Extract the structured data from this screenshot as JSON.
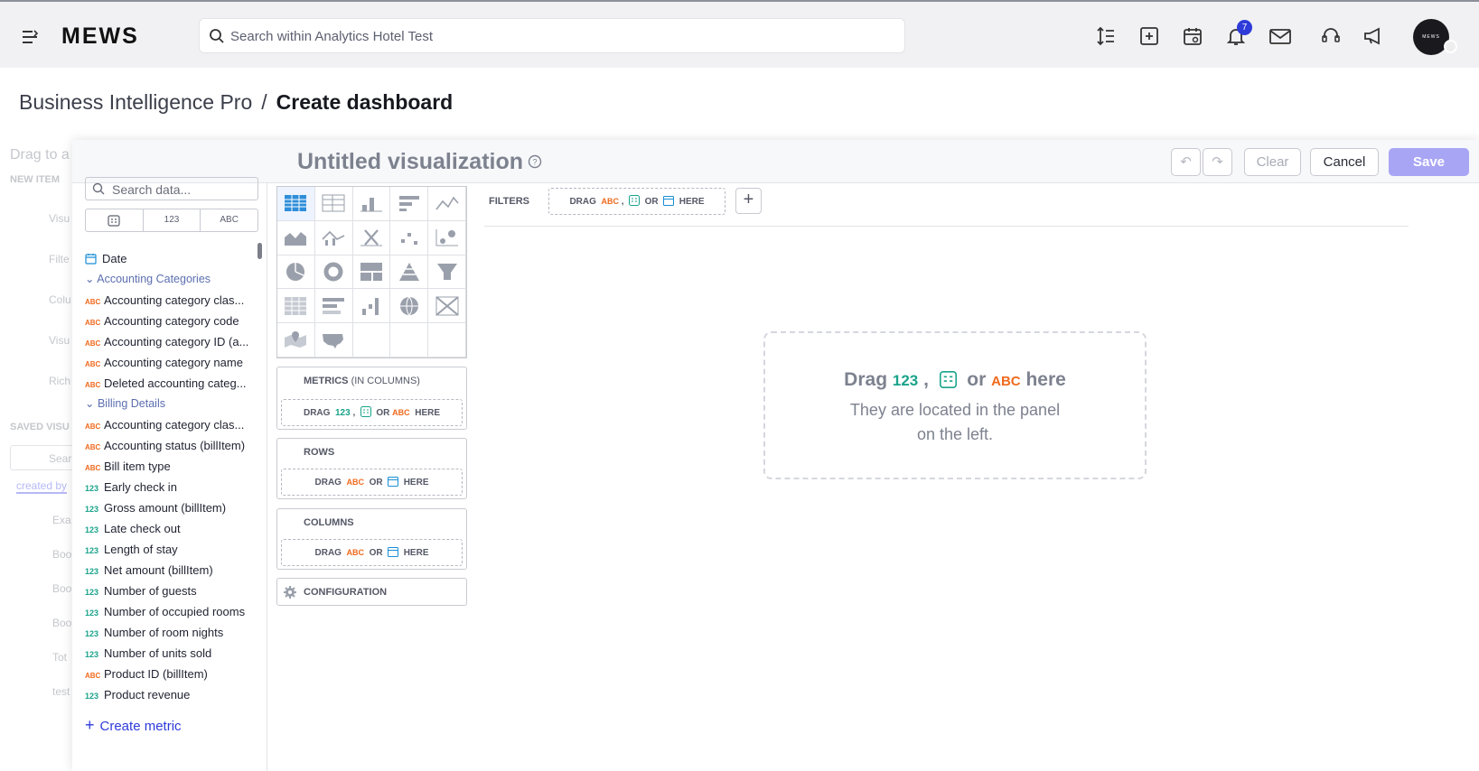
{
  "topbar": {
    "logo": "MEWS",
    "search_placeholder": "Search within Analytics Hotel Test",
    "notifications_count": "7",
    "avatar_text": "MEWS"
  },
  "breadcrumb": {
    "parent": "Business Intelligence Pro",
    "separator": "/",
    "current": "Create dashboard"
  },
  "ghost_panel": {
    "drag_text": "Drag to a",
    "new_item": "NEW ITEM",
    "items": [
      "Visu",
      "Filte",
      "Colu",
      "Visu",
      "Rich"
    ],
    "saved": "SAVED VISU",
    "search": "Searc",
    "created_by": "created by",
    "saved_items": [
      "Exa",
      "Boo",
      "Boo",
      "Boo",
      "Tot",
      "test"
    ]
  },
  "modal": {
    "title": "Untitled visualization",
    "undo_label": "↶",
    "redo_label": "↷",
    "clear_label": "Clear",
    "cancel_label": "Cancel",
    "save_label": "Save"
  },
  "data_panel": {
    "search_placeholder": "Search data...",
    "tabs": [
      "",
      "123",
      "ABC"
    ],
    "date_item": "Date",
    "groups": [
      {
        "name": "Accounting Categories",
        "items": [
          {
            "type": "ABC",
            "label": "Accounting category clas..."
          },
          {
            "type": "ABC",
            "label": "Accounting category code"
          },
          {
            "type": "ABC",
            "label": "Accounting category ID (a..."
          },
          {
            "type": "ABC",
            "label": "Accounting category name"
          },
          {
            "type": "ABC",
            "label": "Deleted accounting categ..."
          }
        ]
      },
      {
        "name": "Billing Details",
        "items": [
          {
            "type": "ABC",
            "label": "Accounting category clas..."
          },
          {
            "type": "ABC",
            "label": "Accounting status (billItem)"
          },
          {
            "type": "ABC",
            "label": "Bill item type"
          },
          {
            "type": "123",
            "label": "Early check in"
          },
          {
            "type": "123",
            "label": "Gross amount (billItem)"
          },
          {
            "type": "123",
            "label": "Late check out"
          },
          {
            "type": "123",
            "label": "Length of stay"
          },
          {
            "type": "123",
            "label": "Net amount (billItem)"
          },
          {
            "type": "123",
            "label": "Number of guests"
          },
          {
            "type": "123",
            "label": "Number of occupied rooms"
          },
          {
            "type": "123",
            "label": "Number of room nights"
          },
          {
            "type": "123",
            "label": "Number of units sold"
          },
          {
            "type": "ABC",
            "label": "Product ID (billItem)"
          },
          {
            "type": "123",
            "label": "Product revenue"
          }
        ]
      }
    ],
    "create_metric": "Create metric"
  },
  "config": {
    "metrics_header": "METRICS",
    "metrics_sub": "(IN COLUMNS)",
    "rows_header": "ROWS",
    "columns_header": "COLUMNS",
    "configuration_label": "CONFIGURATION",
    "drag": "DRAG",
    "or": "OR",
    "here": "HERE",
    "abc": "ABC",
    "num": "123"
  },
  "filters": {
    "label": "FILTERS"
  },
  "empty_state": {
    "drag": "Drag",
    "or": "or",
    "here": "here",
    "num": "123",
    "abc": "ABC",
    "line2a": "They are located in the panel",
    "line2b": "on the left."
  }
}
